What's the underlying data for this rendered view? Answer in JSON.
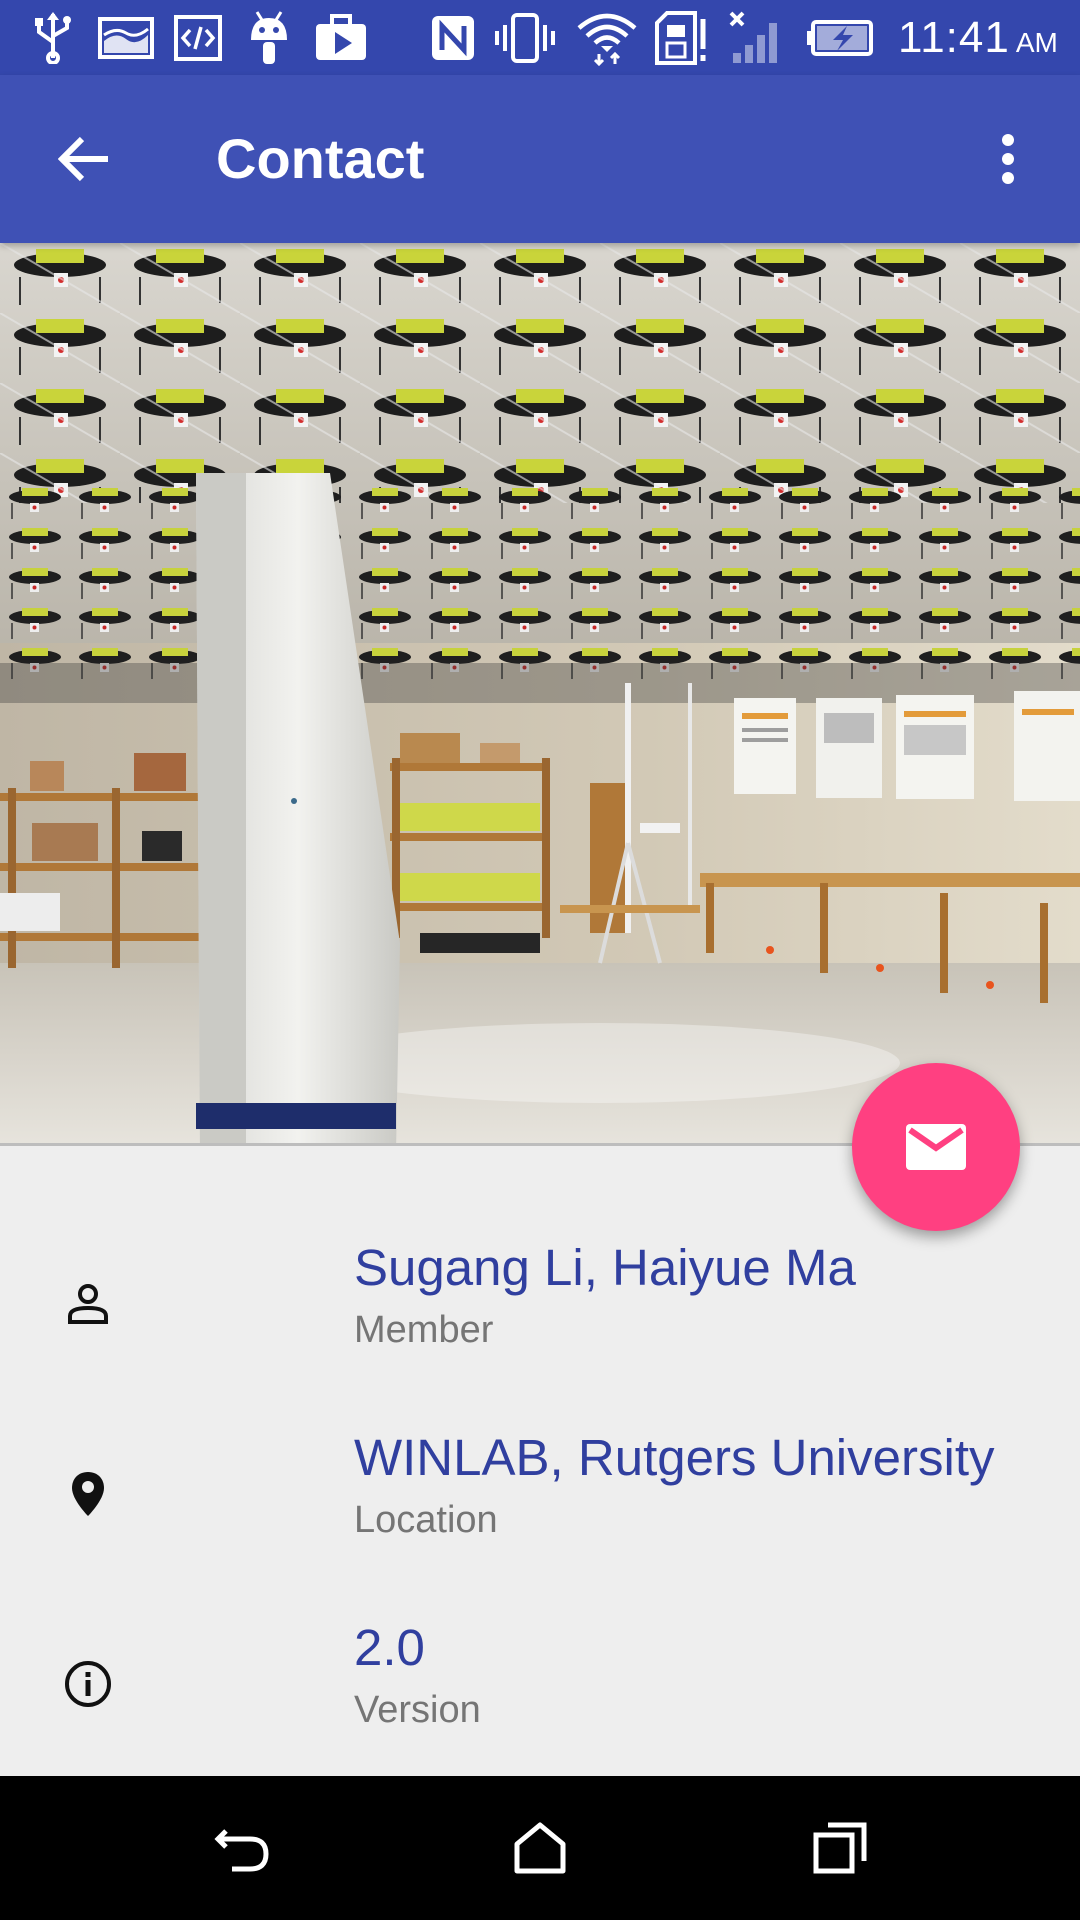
{
  "status_bar": {
    "icons": [
      "usb-icon",
      "image-icon",
      "code-icon",
      "android-icon",
      "briefcase-play-icon",
      "nfc-icon",
      "vibrate-icon",
      "wifi-icon",
      "sd-card-alert-icon",
      "no-signal-icon",
      "battery-charging-icon"
    ],
    "time": "11:41",
    "ampm": "AM"
  },
  "app_bar": {
    "title": "Contact",
    "back_icon": "arrow-back-icon",
    "menu_icon": "more-vert-icon"
  },
  "header_image": {
    "description_icon": "lab-photo"
  },
  "fab": {
    "icon": "email-icon",
    "color": "#ff4081"
  },
  "info": [
    {
      "icon": "person-icon",
      "value": "Sugang Li, Haiyue Ma",
      "label": "Member"
    },
    {
      "icon": "location-pin-icon",
      "value": "WINLAB, Rutgers University",
      "label": "Location"
    },
    {
      "icon": "info-icon",
      "value": "2.0",
      "label": "Version"
    }
  ],
  "nav_bar": {
    "icons": [
      "back-nav-icon",
      "home-nav-icon",
      "recents-nav-icon"
    ]
  },
  "colors": {
    "status_bar": "#3447ad",
    "app_bar": "#3f51b5",
    "accent": "#ff4081",
    "value_text": "#303f9f",
    "label_text": "#757575",
    "background": "#eeeeee"
  }
}
